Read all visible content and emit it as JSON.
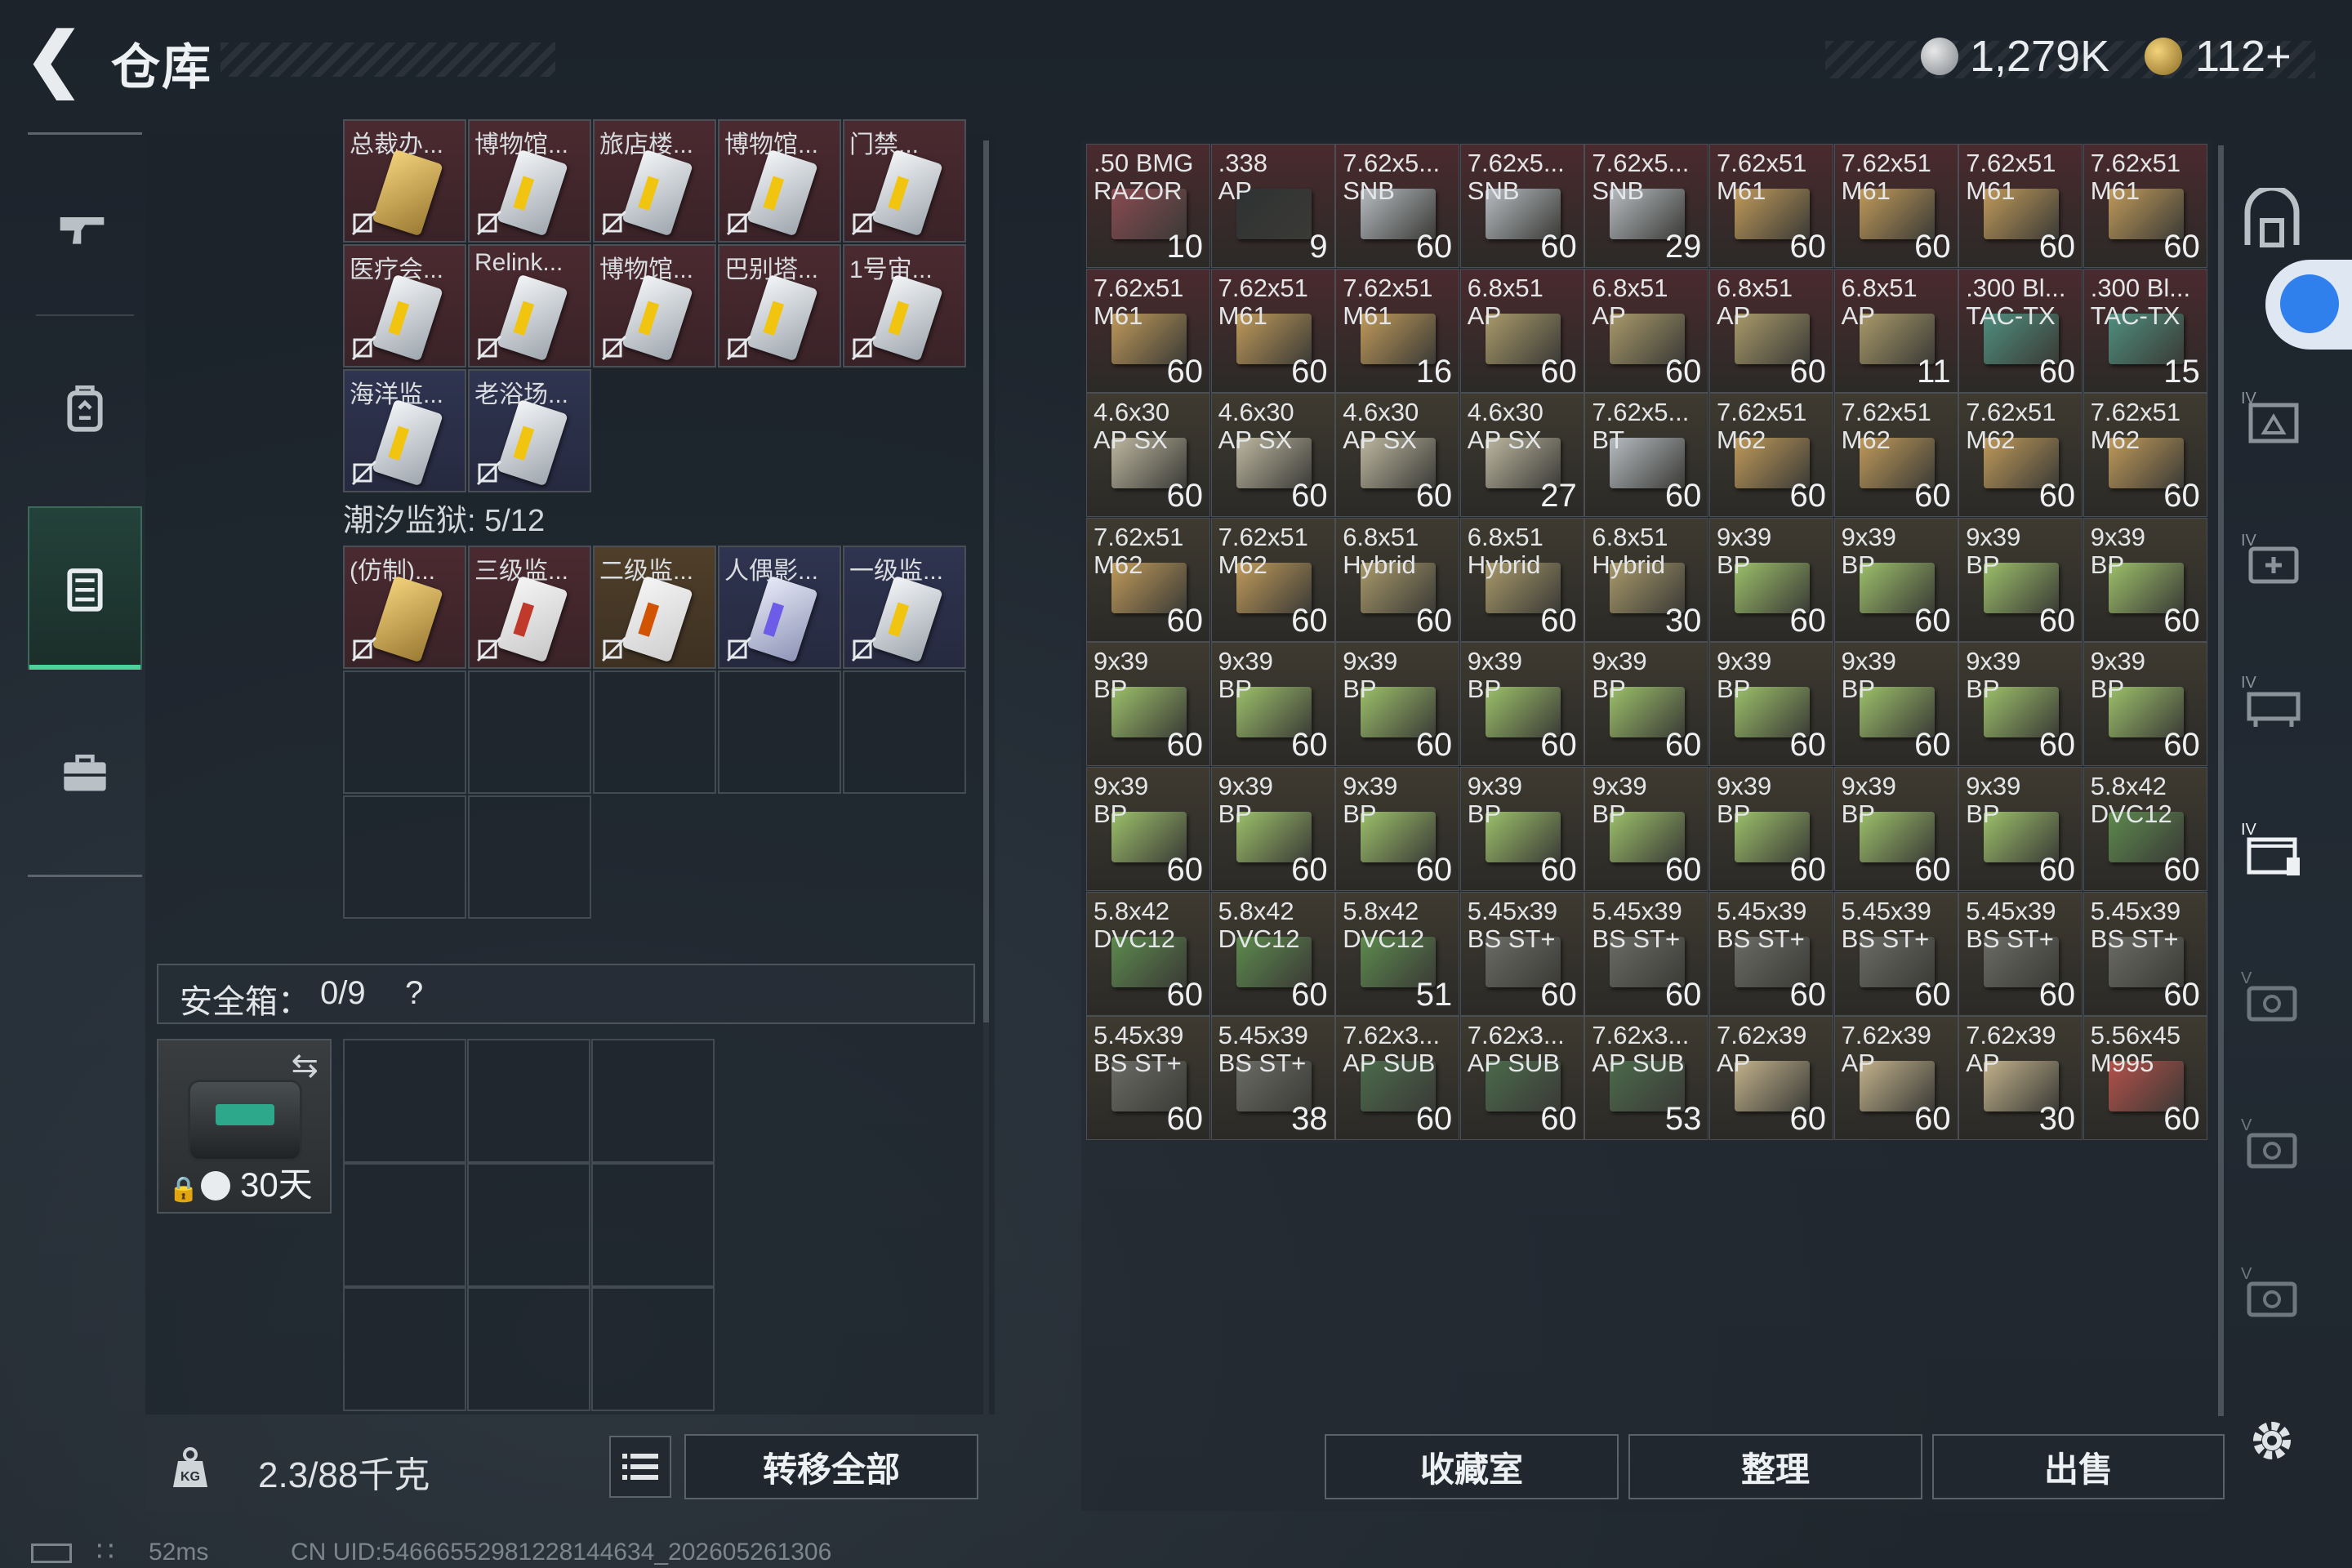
{
  "header": {
    "title": "仓库",
    "currency1": "1,279K",
    "currency2": "112+"
  },
  "keycards_row1": [
    {
      "label": "总裁办...",
      "color": "red",
      "card": "y"
    },
    {
      "label": "博物馆...",
      "color": "red",
      "card": "w"
    },
    {
      "label": "旅店楼...",
      "color": "red",
      "card": "w"
    },
    {
      "label": "博物馆...",
      "color": "red",
      "card": "w"
    },
    {
      "label": "门禁...",
      "color": "red",
      "card": "w"
    }
  ],
  "keycards_row2": [
    {
      "label": "医疗会...",
      "color": "red",
      "card": "w"
    },
    {
      "label": "Relink...",
      "color": "red",
      "card": "w"
    },
    {
      "label": "博物馆...",
      "color": "red",
      "card": "w"
    },
    {
      "label": "巴别塔...",
      "color": "red",
      "card": "w"
    },
    {
      "label": "1号宙...",
      "color": "red",
      "card": "w"
    }
  ],
  "keycards_row3": [
    {
      "label": "海洋监...",
      "color": "blue",
      "card": "w"
    },
    {
      "label": "老浴场...",
      "color": "blue",
      "card": "w"
    }
  ],
  "section_label": "潮汐监狱: 5/12",
  "keycards_row4": [
    {
      "label": "(仿制)...",
      "color": "red",
      "card": "y"
    },
    {
      "label": "三级监...",
      "color": "red",
      "card": "r"
    },
    {
      "label": "二级监...",
      "color": "gold",
      "card": "o"
    },
    {
      "label": "人偶影...",
      "color": "blue",
      "card": "p"
    },
    {
      "label": "一级监...",
      "color": "blue",
      "card": "w"
    }
  ],
  "safe_box": {
    "label": "安全箱：",
    "count": "0/9",
    "help": "?",
    "duration": "30天"
  },
  "weight": {
    "value": "2.3/88千克"
  },
  "buttons": {
    "transfer_all": "转移全部",
    "collection": "收藏室",
    "organize": "整理",
    "sell": "出售"
  },
  "footer": {
    "ping": "52ms",
    "uid": "CN UID:54666552981228144634_202605261306"
  },
  "ammo": [
    {
      "name": ".50 BMG\nRAZOR",
      "qty": "10",
      "bg": "#4a2a2e",
      "box": "#8a4b52"
    },
    {
      "name": ".338\nAP",
      "qty": "9",
      "bg": "#4a2a2e",
      "box": "#2f3233"
    },
    {
      "name": "7.62x5...\nSNB",
      "qty": "60",
      "bg": "#4a2a2e",
      "box": "#b7bcc1"
    },
    {
      "name": "7.62x5...\nSNB",
      "qty": "60",
      "bg": "#4a2a2e",
      "box": "#b7bcc1"
    },
    {
      "name": "7.62x5...\nSNB",
      "qty": "29",
      "bg": "#4a2a2e",
      "box": "#b7bcc1"
    },
    {
      "name": "7.62x51\nM61",
      "qty": "60",
      "bg": "#4a2a2e",
      "box": "#c09a5a"
    },
    {
      "name": "7.62x51\nM61",
      "qty": "60",
      "bg": "#4a2a2e",
      "box": "#c09a5a"
    },
    {
      "name": "7.62x51\nM61",
      "qty": "60",
      "bg": "#4a2a2e",
      "box": "#c09a5a"
    },
    {
      "name": "7.62x51\nM61",
      "qty": "60",
      "bg": "#4a2a2e",
      "box": "#c09a5a"
    },
    {
      "name": "7.62x51\nM61",
      "qty": "60",
      "bg": "#4a2a2e",
      "box": "#c09a5a"
    },
    {
      "name": "7.62x51\nM61",
      "qty": "60",
      "bg": "#4a2a2e",
      "box": "#c09a5a"
    },
    {
      "name": "7.62x51\nM61",
      "qty": "16",
      "bg": "#4a2a2e",
      "box": "#c09a5a"
    },
    {
      "name": "6.8x51\nAP",
      "qty": "60",
      "bg": "#4a2a2e",
      "box": "#a99a6a"
    },
    {
      "name": "6.8x51\nAP",
      "qty": "60",
      "bg": "#4a2a2e",
      "box": "#a99a6a"
    },
    {
      "name": "6.8x51\nAP",
      "qty": "60",
      "bg": "#4a2a2e",
      "box": "#a99a6a"
    },
    {
      "name": "6.8x51\nAP",
      "qty": "11",
      "bg": "#4a2a2e",
      "box": "#a99a6a"
    },
    {
      "name": ".300 Bl...\nTAC-TX",
      "qty": "60",
      "bg": "#4a2a2e",
      "box": "#4f8f7e"
    },
    {
      "name": ".300 Bl...\nTAC-TX",
      "qty": "15",
      "bg": "#4a2a2e",
      "box": "#4f8f7e"
    },
    {
      "name": "4.6x30\nAP SX",
      "qty": "60",
      "bg": "#3e3a30",
      "box": "#bdb7a0"
    },
    {
      "name": "4.6x30\nAP SX",
      "qty": "60",
      "bg": "#3e3a30",
      "box": "#bdb7a0"
    },
    {
      "name": "4.6x30\nAP SX",
      "qty": "60",
      "bg": "#3e3a30",
      "box": "#bdb7a0"
    },
    {
      "name": "4.6x30\nAP SX",
      "qty": "27",
      "bg": "#3e3a30",
      "box": "#bdb7a0"
    },
    {
      "name": "7.62x5...\nBT",
      "qty": "60",
      "bg": "#3e3a30",
      "box": "#b7bcc1"
    },
    {
      "name": "7.62x51\nM62",
      "qty": "60",
      "bg": "#3e3a30",
      "box": "#c09a5a"
    },
    {
      "name": "7.62x51\nM62",
      "qty": "60",
      "bg": "#3e3a30",
      "box": "#c09a5a"
    },
    {
      "name": "7.62x51\nM62",
      "qty": "60",
      "bg": "#3e3a30",
      "box": "#c09a5a"
    },
    {
      "name": "7.62x51\nM62",
      "qty": "60",
      "bg": "#3e3a30",
      "box": "#c09a5a"
    },
    {
      "name": "7.62x51\nM62",
      "qty": "60",
      "bg": "#3e3a30",
      "box": "#c09a5a"
    },
    {
      "name": "7.62x51\nM62",
      "qty": "60",
      "bg": "#3e3a30",
      "box": "#c09a5a"
    },
    {
      "name": "6.8x51\nHybrid",
      "qty": "60",
      "bg": "#3e3a30",
      "box": "#a99a6a"
    },
    {
      "name": "6.8x51\nHybrid",
      "qty": "60",
      "bg": "#3e3a30",
      "box": "#a99a6a"
    },
    {
      "name": "6.8x51\nHybrid",
      "qty": "30",
      "bg": "#3e3a30",
      "box": "#a99a6a"
    },
    {
      "name": "9x39\nBP",
      "qty": "60",
      "bg": "#3e3a30",
      "box": "#9cc06a"
    },
    {
      "name": "9x39\nBP",
      "qty": "60",
      "bg": "#3e3a30",
      "box": "#9cc06a"
    },
    {
      "name": "9x39\nBP",
      "qty": "60",
      "bg": "#3e3a30",
      "box": "#9cc06a"
    },
    {
      "name": "9x39\nBP",
      "qty": "60",
      "bg": "#3e3a30",
      "box": "#9cc06a"
    },
    {
      "name": "9x39\nBP",
      "qty": "60",
      "bg": "#3e3a30",
      "box": "#9cc06a"
    },
    {
      "name": "9x39\nBP",
      "qty": "60",
      "bg": "#3e3a30",
      "box": "#9cc06a"
    },
    {
      "name": "9x39\nBP",
      "qty": "60",
      "bg": "#3e3a30",
      "box": "#9cc06a"
    },
    {
      "name": "9x39\nBP",
      "qty": "60",
      "bg": "#3e3a30",
      "box": "#9cc06a"
    },
    {
      "name": "9x39\nBP",
      "qty": "60",
      "bg": "#3e3a30",
      "box": "#9cc06a"
    },
    {
      "name": "9x39\nBP",
      "qty": "60",
      "bg": "#3e3a30",
      "box": "#9cc06a"
    },
    {
      "name": "9x39\nBP",
      "qty": "60",
      "bg": "#3e3a30",
      "box": "#9cc06a"
    },
    {
      "name": "9x39\nBP",
      "qty": "60",
      "bg": "#3e3a30",
      "box": "#9cc06a"
    },
    {
      "name": "9x39\nBP",
      "qty": "60",
      "bg": "#3e3a30",
      "box": "#9cc06a"
    },
    {
      "name": "9x39\nBP",
      "qty": "60",
      "bg": "#3e3a30",
      "box": "#9cc06a"
    },
    {
      "name": "9x39\nBP",
      "qty": "60",
      "bg": "#3e3a30",
      "box": "#9cc06a"
    },
    {
      "name": "9x39\nBP",
      "qty": "60",
      "bg": "#3e3a30",
      "box": "#9cc06a"
    },
    {
      "name": "9x39\nBP",
      "qty": "60",
      "bg": "#3e3a30",
      "box": "#9cc06a"
    },
    {
      "name": "9x39\nBP",
      "qty": "60",
      "bg": "#3e3a30",
      "box": "#9cc06a"
    },
    {
      "name": "9x39\nBP",
      "qty": "60",
      "bg": "#3e3a30",
      "box": "#9cc06a"
    },
    {
      "name": "9x39\nBP",
      "qty": "60",
      "bg": "#3e3a30",
      "box": "#9cc06a"
    },
    {
      "name": "9x39\nBP",
      "qty": "60",
      "bg": "#3e3a30",
      "box": "#9cc06a"
    },
    {
      "name": "5.8x42\nDVC12",
      "qty": "60",
      "bg": "#3e3a30",
      "box": "#5d8a4e"
    },
    {
      "name": "5.8x42\nDVC12",
      "qty": "60",
      "bg": "#3e3a30",
      "box": "#5d8a4e"
    },
    {
      "name": "5.8x42\nDVC12",
      "qty": "60",
      "bg": "#3e3a30",
      "box": "#5d8a4e"
    },
    {
      "name": "5.8x42\nDVC12",
      "qty": "51",
      "bg": "#3e3a30",
      "box": "#5d8a4e"
    },
    {
      "name": "5.45x39\nBS ST+",
      "qty": "60",
      "bg": "#3e3a30",
      "box": "#6b6b66"
    },
    {
      "name": "5.45x39\nBS ST+",
      "qty": "60",
      "bg": "#3e3a30",
      "box": "#6b6b66"
    },
    {
      "name": "5.45x39\nBS ST+",
      "qty": "60",
      "bg": "#3e3a30",
      "box": "#6b6b66"
    },
    {
      "name": "5.45x39\nBS ST+",
      "qty": "60",
      "bg": "#3e3a30",
      "box": "#6b6b66"
    },
    {
      "name": "5.45x39\nBS ST+",
      "qty": "60",
      "bg": "#3e3a30",
      "box": "#6b6b66"
    },
    {
      "name": "5.45x39\nBS ST+",
      "qty": "60",
      "bg": "#3e3a30",
      "box": "#6b6b66"
    },
    {
      "name": "5.45x39\nBS ST+",
      "qty": "60",
      "bg": "#3e3a30",
      "box": "#6b6b66"
    },
    {
      "name": "5.45x39\nBS ST+",
      "qty": "38",
      "bg": "#3e3a30",
      "box": "#6b6b66"
    },
    {
      "name": "7.62x3...\nAP SUB",
      "qty": "60",
      "bg": "#3e3a30",
      "box": "#4b6a4b"
    },
    {
      "name": "7.62x3...\nAP SUB",
      "qty": "60",
      "bg": "#3e3a30",
      "box": "#4b6a4b"
    },
    {
      "name": "7.62x3...\nAP SUB",
      "qty": "53",
      "bg": "#3e3a30",
      "box": "#4b6a4b"
    },
    {
      "name": "7.62x39\nAP",
      "qty": "60",
      "bg": "#3e3a30",
      "box": "#c2b28c"
    },
    {
      "name": "7.62x39\nAP",
      "qty": "60",
      "bg": "#3e3a30",
      "box": "#c2b28c"
    },
    {
      "name": "7.62x39\nAP",
      "qty": "30",
      "bg": "#3e3a30",
      "box": "#c2b28c"
    },
    {
      "name": "5.56x45\nM995",
      "qty": "60",
      "bg": "#3e3a30",
      "box": "#b5504a"
    }
  ]
}
